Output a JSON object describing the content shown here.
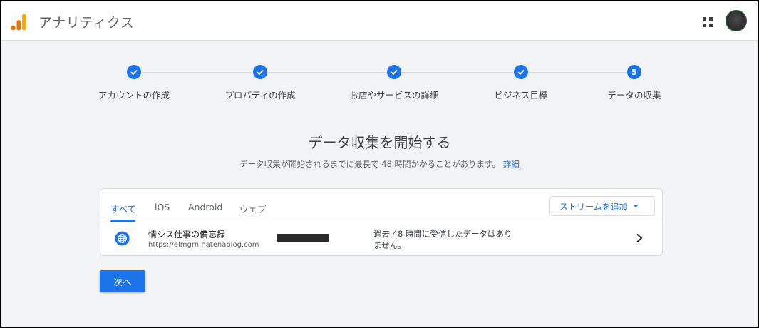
{
  "header": {
    "app_title": "アナリティクス",
    "logo_icon": "analytics-logo-icon",
    "apps_icon": "apps-grid-icon",
    "avatar_icon": "user-avatar"
  },
  "stepper": {
    "steps": [
      {
        "label": "アカウントの作成",
        "state": "done",
        "marker": "check"
      },
      {
        "label": "プロパティの作成",
        "state": "done",
        "marker": "check"
      },
      {
        "label": "お店やサービスの詳細",
        "state": "done",
        "marker": "check"
      },
      {
        "label": "ビジネス目標",
        "state": "done",
        "marker": "check"
      },
      {
        "label": "データの収集",
        "state": "current",
        "marker": "5"
      }
    ]
  },
  "main": {
    "title": "データ収集を開始する",
    "subtitle": "データ収集が開始されるまでに最長で 48 時間かかることがあります。",
    "details_link": "詳細"
  },
  "card": {
    "tabs": [
      "すべて",
      "iOS",
      "Android",
      "ウェブ"
    ],
    "active_tab": "すべて",
    "add_stream_button": "ストリームを追加",
    "stream": {
      "name": "情シス仕事の備忘録",
      "url": "https://elmgrn.hatenablog.com",
      "status_line1": "過去 48 時間に受信したデータはあり",
      "status_line2": "ません。"
    }
  },
  "next_button": "次へ",
  "colors": {
    "accent": "#1a73e8",
    "background": "#f1f3f4",
    "logo_orange": "#f9ab00",
    "logo_dark_orange": "#e37400"
  }
}
